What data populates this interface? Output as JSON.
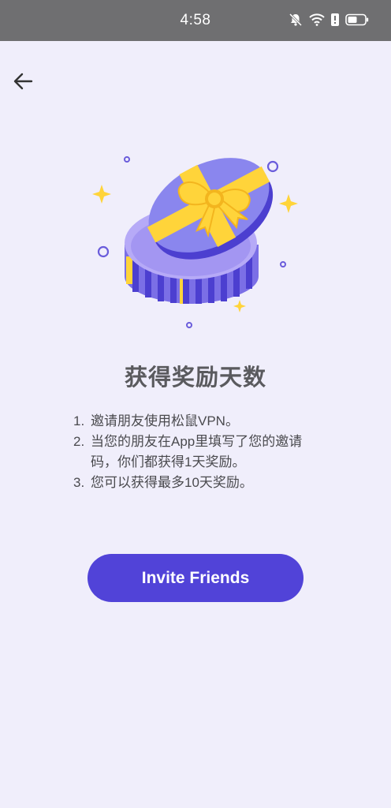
{
  "status_bar": {
    "time": "4:58",
    "icons": [
      "mute-bell-icon",
      "wifi-icon",
      "alert-icon",
      "battery-icon"
    ]
  },
  "nav": {
    "back_icon": "arrow-left-icon"
  },
  "illustration": {
    "icon": "gift-box-icon",
    "colors": {
      "box": "#7b6fe6",
      "lid": "#8a86ee",
      "ribbon": "#ffd43a",
      "stripes": "#4c3fd0"
    }
  },
  "reward": {
    "title": "获得奖励天数",
    "steps": [
      {
        "num": "1.",
        "text": "邀请朋友使用松鼠VPN。"
      },
      {
        "num": "2.",
        "text": "当您的朋友在App里填写了您的邀请码，你们都获得1天奖励。"
      },
      {
        "num": "3.",
        "text": "您可以获得最多10天奖励。"
      }
    ]
  },
  "actions": {
    "invite_label": "Invite Friends"
  },
  "colors": {
    "accent": "#5143d8",
    "background": "#f0eefb",
    "status_bar": "#6f6f71"
  }
}
